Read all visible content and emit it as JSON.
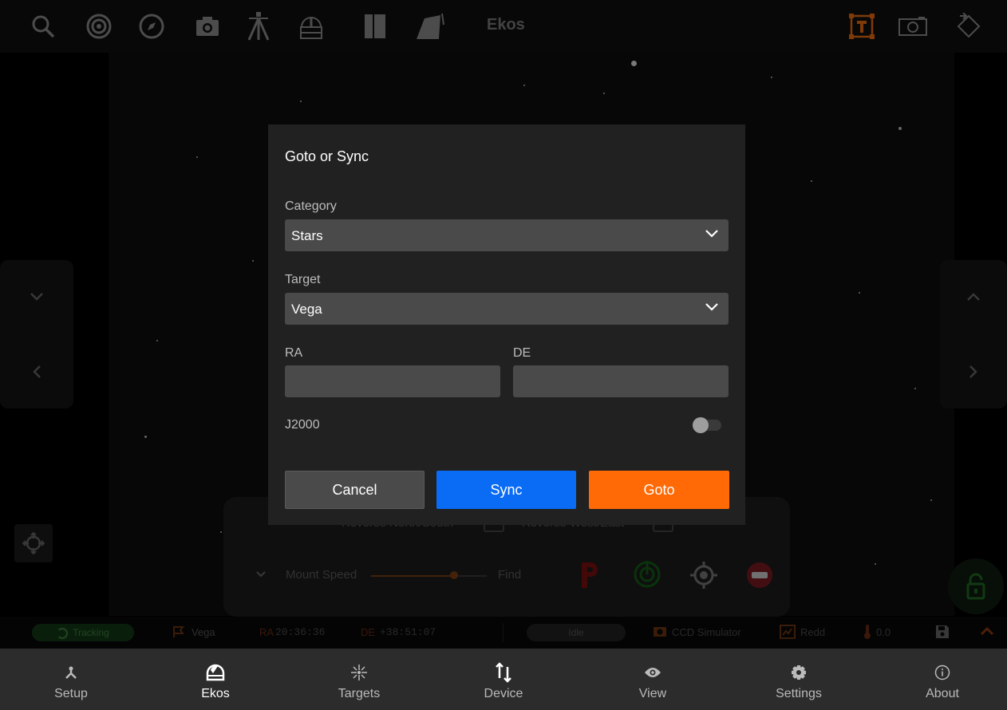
{
  "app": {
    "title": "Ekos"
  },
  "toolbar": {
    "icons": [
      "search-icon",
      "target-icon",
      "compass-icon",
      "camera-icon",
      "telescope-icon",
      "observatory-icon",
      "book-icon",
      "telescope-mount-icon",
      "text-box-icon",
      "frame-icon",
      "rotate-icon"
    ]
  },
  "mount_panel": {
    "reverse_ns": "Reverse North/South",
    "reverse_we": "Reverse West/East",
    "speed_label": "Mount Speed",
    "speed_value": "Find"
  },
  "statusbar": {
    "tracking": "Tracking",
    "target": "Vega",
    "ra_label": "RA",
    "ra_value": "20:36:36",
    "de_label": "DE",
    "de_value": "+38:51:07",
    "state": "Idle",
    "camera": "CCD Simulator",
    "filter": "Redd",
    "temperature": "0.0"
  },
  "dialog": {
    "title": "Goto or Sync",
    "category_label": "Category",
    "category_value": "Stars",
    "target_label": "Target",
    "target_value": "Vega",
    "ra_label": "RA",
    "ra_value": "",
    "de_label": "DE",
    "de_value": "",
    "j2000_label": "J2000",
    "j2000_enabled": false,
    "cancel_label": "Cancel",
    "sync_label": "Sync",
    "goto_label": "Goto"
  },
  "bottom_nav": [
    {
      "label": "Setup",
      "icon": "setup-icon"
    },
    {
      "label": "Ekos",
      "icon": "ekos-dome-icon",
      "active": true
    },
    {
      "label": "Targets",
      "icon": "targets-icon"
    },
    {
      "label": "Device",
      "icon": "device-icon"
    },
    {
      "label": "View",
      "icon": "eye-icon"
    },
    {
      "label": "Settings",
      "icon": "gear-icon"
    },
    {
      "label": "About",
      "icon": "info-icon"
    }
  ],
  "colors": {
    "sync": "#0a6cf5",
    "goto": "#ff6a06",
    "accent_orange": "#e86a10",
    "tracking_green": "#2e7d32"
  }
}
